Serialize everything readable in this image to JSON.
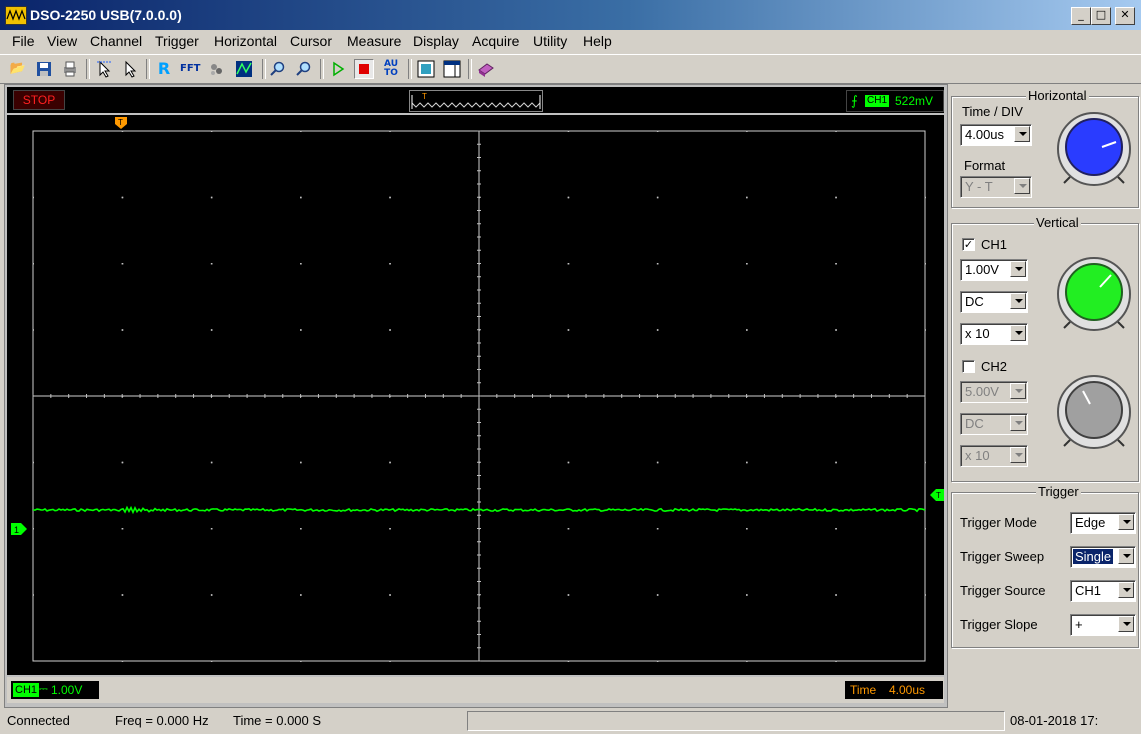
{
  "window": {
    "title": "DSO-2250 USB(7.0.0.0)",
    "minimize": "_",
    "maximize": "□",
    "close": "✕"
  },
  "menu": [
    "File",
    "View",
    "Channel",
    "Trigger",
    "Horizontal",
    "Cursor",
    "Measure",
    "Display",
    "Acquire",
    "Utility",
    "Help"
  ],
  "toolbar": {
    "icons": [
      "open-icon",
      "save-icon",
      "print-icon",
      "pointer-cursor-icon",
      "select-cursor-icon",
      "ref-icon",
      "fft-icon",
      "math-icon",
      "wave-icon",
      "zoom-in-icon",
      "zoom-out-icon",
      "run-icon",
      "stop-icon",
      "auto-icon",
      "fit-icon",
      "window-icon",
      "help-book-icon"
    ],
    "ref_label": "R",
    "fft_label": "FFT",
    "auto_label": "AU TO"
  },
  "scope": {
    "run_state": "STOP",
    "trigger_marker": "T",
    "trigger_channel": "CH1",
    "trigger_level": "522mV",
    "ch1_marker": "1",
    "trigger_level_marker": "T",
    "ch1_tag": "CH1",
    "ch1_coupling_symbol": "⎓",
    "ch1_scale": "1.00V",
    "time_label": "Time",
    "time_value": "4.00us",
    "colors": {
      "trace": "#00ff00",
      "grid": "#c8c8c8",
      "trigger": "#ff9900",
      "stop": "#ff2020"
    }
  },
  "horizontal": {
    "title": "Horizontal",
    "time_div_label": "Time / DIV",
    "time_div_value": "4.00us",
    "format_label": "Format",
    "format_value": "Y - T",
    "knob_color": "#2a3cff"
  },
  "vertical": {
    "title": "Vertical",
    "ch1": {
      "label": "CH1",
      "checked": true,
      "volts": "1.00V",
      "coupling": "DC",
      "probe": "x 10",
      "knob_color": "#22ee22"
    },
    "ch2": {
      "label": "CH2",
      "checked": false,
      "volts": "5.00V",
      "coupling": "DC",
      "probe": "x 10",
      "knob_color": "#a0a0a0"
    }
  },
  "trigger": {
    "title": "Trigger",
    "mode_label": "Trigger Mode",
    "mode_value": "Edge",
    "sweep_label": "Trigger Sweep",
    "sweep_value": "Single",
    "source_label": "Trigger Source",
    "source_value": "CH1",
    "slope_label": "Trigger Slope",
    "slope_value": "+"
  },
  "status": {
    "connection": "Connected",
    "freq": "Freq = 0.000 Hz",
    "time": "Time = 0.000 S",
    "datetime": "08-01-2018  17:"
  }
}
